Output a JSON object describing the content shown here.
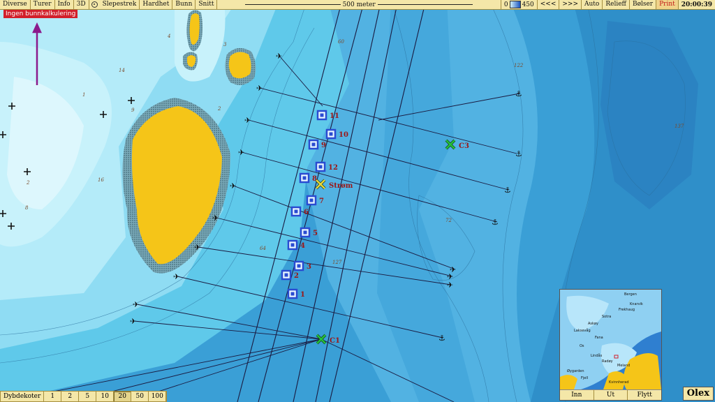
{
  "toolbar": {
    "menu_items": [
      "Diverse",
      "Turer",
      "Info",
      "3D"
    ],
    "menu_items2": [
      "Slepestrek",
      "Hardhet",
      "Bunn",
      "Snitt"
    ],
    "scale_label": "500 meter",
    "depth_min": "0",
    "depth_max": "450",
    "nav_back": "<<<",
    "nav_fwd": ">>>",
    "right_items": [
      "Auto",
      "Relieff",
      "Bølser"
    ],
    "print_label": "Print",
    "clock": "20:00:39"
  },
  "warning": "Ingen bunnkalkulering",
  "markers": [
    {
      "label": "11"
    },
    {
      "label": "10"
    },
    {
      "label": "9"
    },
    {
      "label": "12"
    },
    {
      "label": "8"
    },
    {
      "label": "7"
    },
    {
      "label": "6"
    },
    {
      "label": "5"
    },
    {
      "label": "4"
    },
    {
      "label": "3"
    },
    {
      "label": "2"
    },
    {
      "label": "1"
    }
  ],
  "crosses": [
    {
      "label": "C3",
      "color": "#22c23a"
    },
    {
      "label": "Strøm",
      "color": "#e8d63a"
    },
    {
      "label": "C1",
      "color": "#22c23a"
    }
  ],
  "depth_labels": [
    "60",
    "122",
    "137",
    "14",
    "16",
    "72",
    "64",
    "127",
    "8",
    "2",
    "1",
    "3",
    "4",
    "2",
    "9"
  ],
  "depth_curves": {
    "label": "Dybdekoter",
    "options": [
      "1",
      "2",
      "5",
      "10",
      "20",
      "50",
      "100"
    ],
    "selected": "20"
  },
  "minimap": {
    "place_names": [
      "Bergen",
      "Knarvik",
      "Frekhaug",
      "Sotra",
      "Askøy",
      "Laksevåg",
      "Fana",
      "Os",
      "Lindås",
      "Radøy",
      "Meland",
      "Øygarden",
      "Fjell",
      "Kvinnherad"
    ],
    "buttons": [
      "Inn",
      "Ut",
      "Flytt"
    ]
  },
  "brand": "Olex",
  "colors": {
    "shallow": "#c8f2fb",
    "mid": "#5fc9ea",
    "deep": "#3a9fd6",
    "land": "#f5c518",
    "marker_fill": "#2a4bd1",
    "label_red": "#9c1616",
    "panel": "#f4e7a8"
  }
}
